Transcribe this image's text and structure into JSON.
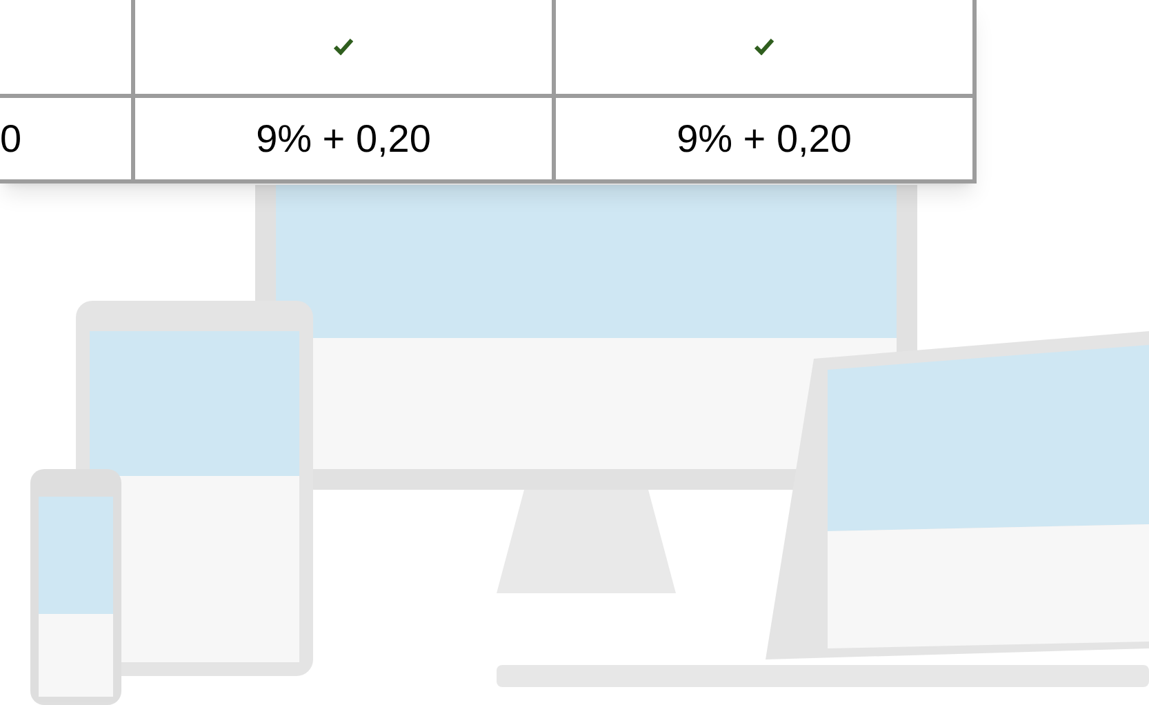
{
  "table": {
    "rows": [
      {
        "cells": [
          {
            "kind": "check",
            "checked": false
          },
          {
            "kind": "check",
            "checked": true
          },
          {
            "kind": "check",
            "checked": true
          }
        ]
      },
      {
        "cells": [
          {
            "kind": "text",
            "text": "0"
          },
          {
            "kind": "text",
            "text": "9% + 0,20"
          },
          {
            "kind": "text",
            "text": "9% + 0,20"
          }
        ]
      }
    ]
  }
}
